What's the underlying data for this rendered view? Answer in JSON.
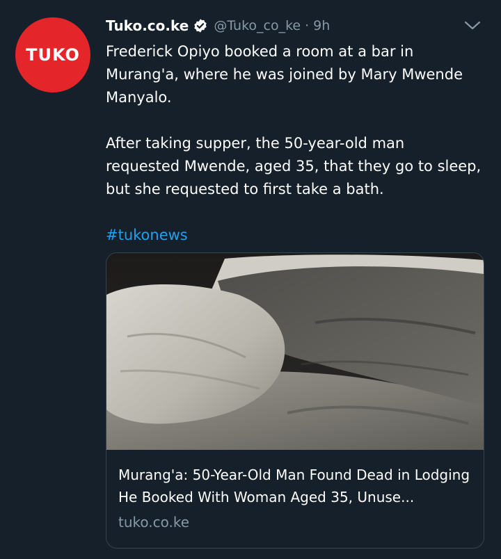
{
  "tweet": {
    "author": {
      "name": "Tuko.co.ke",
      "handle": "@Tuko_co_ke",
      "separator": "·",
      "time": "9h",
      "avatar_text": "TUKO",
      "avatar_color": "#e4262b",
      "verified": true
    },
    "text": {
      "paragraph1": "Frederick Opiyo booked a room at a bar in Murang'a, where he was joined by Mary Mwende Manyalo.",
      "paragraph2": "After taking supper, the 50-year-old man requested Mwende, aged 35, that they go to sleep, but she requested to first take a bath.",
      "hashtag": "#tukonews"
    },
    "card": {
      "image_icon": "bed-photo",
      "title": "Murang'a: 50-Year-Old Man Found Dead in Lodging He Booked With Woman Aged 35, Unuse...",
      "domain": "tuko.co.ke"
    }
  },
  "colors": {
    "background": "#15202b",
    "text": "#ffffff",
    "muted": "#8899a6",
    "link": "#1da1f2",
    "border": "#38444d"
  }
}
